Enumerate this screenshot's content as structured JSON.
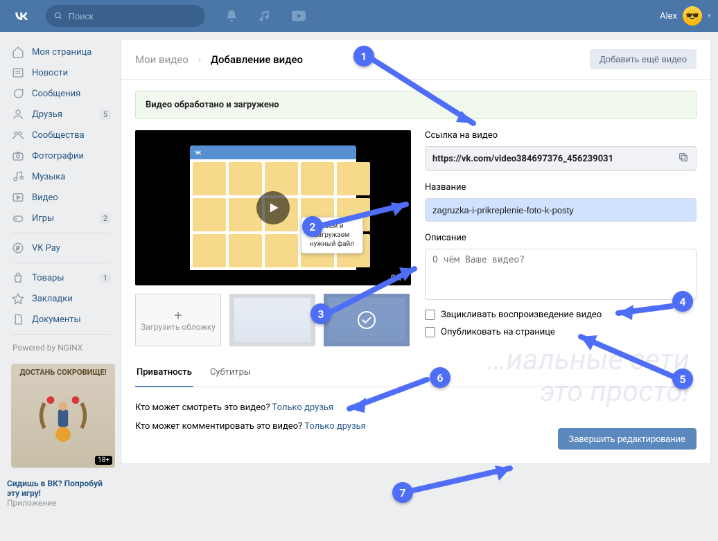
{
  "header": {
    "search_placeholder": "Поиск",
    "user_name": "Alex"
  },
  "sidebar": {
    "items": [
      {
        "label": "Моя страница"
      },
      {
        "label": "Новости"
      },
      {
        "label": "Сообщения"
      },
      {
        "label": "Друзья",
        "badge": "5"
      },
      {
        "label": "Сообщества"
      },
      {
        "label": "Фотографии"
      },
      {
        "label": "Музыка"
      },
      {
        "label": "Видео"
      },
      {
        "label": "Игры",
        "badge": "2"
      }
    ],
    "items2": [
      {
        "label": "VK Pay"
      }
    ],
    "items3": [
      {
        "label": "Товары",
        "badge": "1"
      },
      {
        "label": "Закладки"
      },
      {
        "label": "Документы"
      }
    ],
    "powered": "Powered by NGINX"
  },
  "ad": {
    "banner_top": "ДОСТАНЬ СОКРОВИЩЕ!",
    "age": "18+",
    "title": "Сидишь в ВК? Попробуй эту игру!",
    "sub": "Приложение"
  },
  "breadcrumb": {
    "root": "Мои видео",
    "current": "Добавление видео",
    "add_more": "Добавить ещё видео"
  },
  "alert": "Видео обработано и загружено",
  "video": {
    "duration": "0:11",
    "tooltip": "…аем и загружаем нужный файл",
    "upload_thumb": "Загрузить обложку"
  },
  "form": {
    "link_label": "Ссылка на видео",
    "link_value": "https://vk.com/video384697376_456239031",
    "title_label": "Название",
    "title_value": "zagruzka-i-prikreplenie-foto-k-posty",
    "desc_label": "Описание",
    "desc_placeholder": "О чём Ваше видео?",
    "loop_label": "Зацикливать воспроизведение видео",
    "publish_label": "Опубликовать на странице"
  },
  "tabs": {
    "privacy": "Приватность",
    "subtitles": "Субтитры"
  },
  "privacy": {
    "who_view_q": "Кто может смотреть это видео? ",
    "who_view_a": "Только друзья",
    "who_comment_q": "Кто может комментировать это видео? ",
    "who_comment_a": "Только друзья"
  },
  "submit": "Завершить редактирование",
  "watermark_l1": "…иальные сети",
  "watermark_l2": "это просто!",
  "annotations": [
    "1",
    "2",
    "3",
    "4",
    "5",
    "6",
    "7"
  ]
}
